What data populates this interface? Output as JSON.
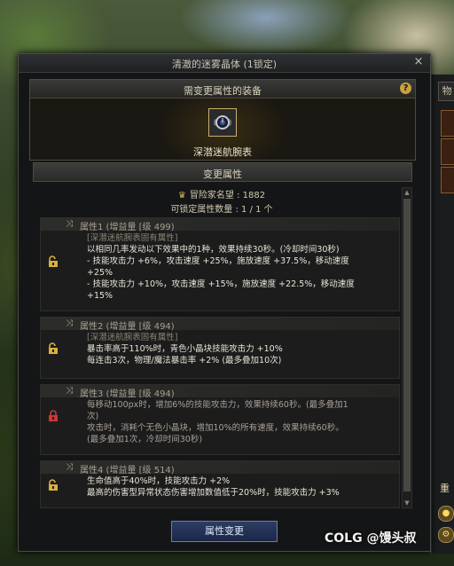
{
  "window": {
    "title": "清澈的迷雾晶体 (1锁定)",
    "close": "×"
  },
  "equip": {
    "header": "需变更属性的装备",
    "help": "?",
    "item_name": "深潜迷航腕表"
  },
  "change_header": "变更属性",
  "info": {
    "reputation_label": "冒险家名望 : 1882",
    "lockable": "可锁定属性数量 :   1 / 1 个"
  },
  "attributes": [
    {
      "title": "属性1 (增益量 [级 499)",
      "locked": false,
      "lines": [
        "[深潜迷航腕表固有属性]",
        "以相同几率发动以下效果中的1种，效果持续30秒。(冷却时间30秒)",
        "- 技能攻击力 +6%，攻击速度 +25%，施放速度 +37.5%，移动速度",
        "+25%",
        "- 技能攻击力 +10%，攻击速度 +15%，施放速度 +22.5%，移动速度",
        "+15%"
      ]
    },
    {
      "title": "属性2 (增益量 [级 494)",
      "locked": false,
      "lines": [
        "[深潜迷航腕表固有属性]",
        "暴击率高于110%时，青色小晶块技能攻击力 +10%",
        "每连击3次，物理/魔法暴击率 +2% (最多叠加10次)"
      ]
    },
    {
      "title": "属性3 (增益量 [级 494)",
      "locked": true,
      "lines": [
        "每移动100px时，增加6%的技能攻击力，效果持续60秒。(最多叠加1",
        "次)",
        "攻击时，消耗个无色小晶块，增加10%的所有速度，效果持续60秒。",
        "(最多叠加1次，冷却时间30秒)"
      ]
    },
    {
      "title": "属性4 (增益量 [级 514)",
      "locked": false,
      "lines": [
        "生命值高于40%时，技能攻击力 +2%",
        "最高的伤害型异常状态伤害增加数值低于20%时，技能攻击力 +3%"
      ]
    }
  ],
  "button": {
    "change": "属性变更"
  },
  "side": {
    "tab": "物",
    "label": "重"
  },
  "watermark": "COLG @馒头叔",
  "colors": {
    "source_line": "#8c8474",
    "text": "#e8e4d8",
    "button": "#2c3e66",
    "lock_open": "#d8b040",
    "lock_closed": "#c83838"
  }
}
